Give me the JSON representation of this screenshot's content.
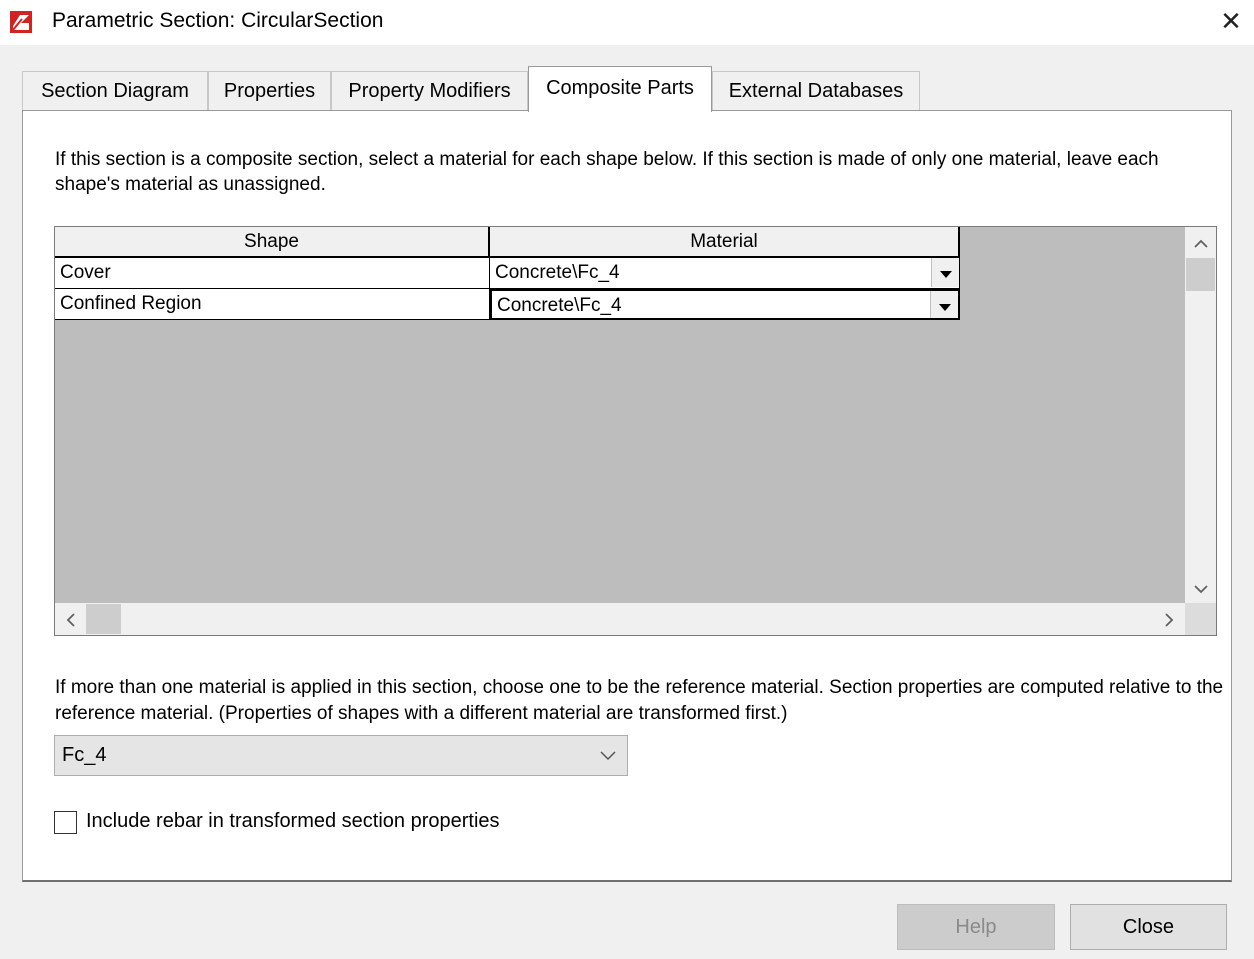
{
  "window": {
    "title": "Parametric Section: CircularSection",
    "close_glyph": "✕"
  },
  "tabs": [
    {
      "label": "Section Diagram",
      "active": false
    },
    {
      "label": "Properties",
      "active": false
    },
    {
      "label": "Property Modifiers",
      "active": false
    },
    {
      "label": "Composite Parts",
      "active": true
    },
    {
      "label": "External Databases",
      "active": false
    }
  ],
  "composite": {
    "intro_text": "If this section is a composite section, select a material for each shape below.  If this section is made of only one material, leave each shape's material as unassigned.",
    "grid": {
      "headers": {
        "shape": "Shape",
        "material": "Material"
      },
      "rows": [
        {
          "shape": "Cover",
          "material": "Concrete\\Fc_4"
        },
        {
          "shape": "Confined Region",
          "material": "Concrete\\Fc_4"
        }
      ]
    },
    "reference_text": "If more than one material is applied in this section, choose one to be the reference material. Section properties are computed relative to the reference material. (Properties of shapes with a different material are transformed first.)",
    "reference_material": "Fc_4",
    "include_rebar": {
      "label": "Include rebar in transformed section properties",
      "checked": false
    }
  },
  "buttons": {
    "help": "Help",
    "close": "Close"
  },
  "icons": {
    "app": "app-logo-icon",
    "dropdown": "dropdown-arrow-icon",
    "chevron": "chevron-down-icon",
    "scroll_up": "scroll-up-icon",
    "scroll_down": "scroll-down-icon",
    "scroll_left": "scroll-left-icon",
    "scroll_right": "scroll-right-icon"
  },
  "colors": {
    "app_icon": "#d32222",
    "help_disabled_text": "#8a8a8a",
    "grid_background": "#bdbdbd"
  }
}
